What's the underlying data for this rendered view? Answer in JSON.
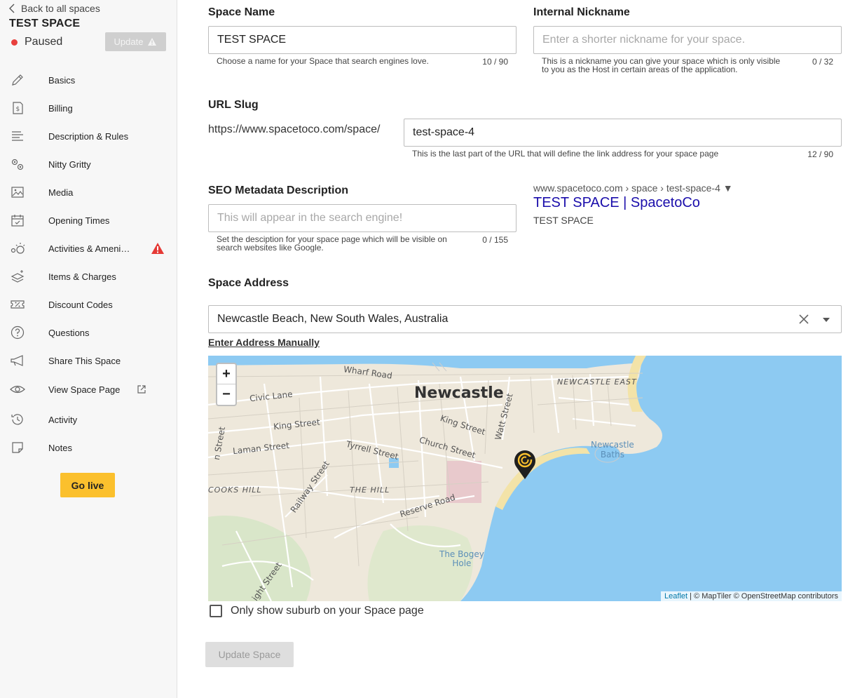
{
  "sidebar": {
    "back_label": "Back to all spaces",
    "space_title": "TEST SPACE",
    "status": "Paused",
    "status_color": "#e8403d",
    "update_label": "Update",
    "items": [
      {
        "label": "Basics",
        "icon": "pencil-icon"
      },
      {
        "label": "Billing",
        "icon": "invoice-icon"
      },
      {
        "label": "Description & Rules",
        "icon": "text-lines-icon"
      },
      {
        "label": "Nitty Gritty",
        "icon": "gears-icon"
      },
      {
        "label": "Media",
        "icon": "image-icon"
      },
      {
        "label": "Opening Times",
        "icon": "calendar-icon"
      },
      {
        "label": "Activities & Ameni…",
        "icon": "activities-icon"
      },
      {
        "label": "Items & Charges",
        "icon": "layers-icon"
      },
      {
        "label": "Discount Codes",
        "icon": "ticket-icon"
      },
      {
        "label": "Questions",
        "icon": "question-icon"
      },
      {
        "label": "Share This Space",
        "icon": "megaphone-icon"
      },
      {
        "label": "View Space Page",
        "icon": "eye-icon"
      },
      {
        "label": "Activity",
        "icon": "history-icon"
      },
      {
        "label": "Notes",
        "icon": "note-icon"
      }
    ],
    "go_live_label": "Go live",
    "accent_color": "#fbc02d"
  },
  "form": {
    "space_name": {
      "label": "Space Name",
      "value": "TEST SPACE",
      "helper": "Choose a name for your Space that search engines love.",
      "counter": "10 / 90"
    },
    "nickname": {
      "label": "Internal Nickname",
      "placeholder": "Enter a shorter nickname for your space.",
      "helper_line1": "This is a nickname you can give your space which is only visible",
      "helper_line2": "to you as the Host in certain areas of the application.",
      "counter": "0 / 32"
    },
    "url_slug": {
      "label": "URL Slug",
      "prefix": "https://www.spacetoco.com/space/",
      "value": "test-space-4",
      "helper": "This is the last part of the URL that will define the link address for your space page",
      "counter": "12 / 90"
    },
    "seo": {
      "label": "SEO Metadata Description",
      "placeholder": "This will appear in the search engine!",
      "helper_line1": "Set the desciption for your space page which will be visible on",
      "helper_line2": "search websites like Google.",
      "counter": "0 / 155",
      "preview_url": "www.spacetoco.com › space › test-space-4 ▼",
      "preview_title": "TEST SPACE | SpacetoCo",
      "preview_desc": "TEST SPACE"
    },
    "address": {
      "label": "Space Address",
      "value": "Newcastle Beach, New South Wales, Australia",
      "manual_link": "Enter Address Manually"
    },
    "map": {
      "zoom_in": "+",
      "zoom_out": "−",
      "attribution_leaflet": "Leaflet",
      "attribution_rest": " | © MapTiler © OpenStreetMap contributors",
      "labels": {
        "city": "Newcastle",
        "wharf": "Wharf Road",
        "civic": "Civic Lane",
        "king1": "King Street",
        "king2": "King Street",
        "laman": "Laman Street",
        "tyrrell": "Tyrrell Street",
        "church": "Church Street",
        "watt": "Watt Street",
        "newcastle_east": "NEWCASTLE EAST",
        "baths": "Newcastle\nBaths",
        "cooks_hill": "COOKS HILL",
        "the_hill": "THE HILL",
        "railway": "Railway Street",
        "reserve": "Reserve Road",
        "bogey": "The Bogey\nHole",
        "street_left": "n Street",
        "light_street": "ight Street"
      }
    },
    "suburb_checkbox_label": "Only show suburb on your Space page",
    "update_space_label": "Update Space"
  }
}
